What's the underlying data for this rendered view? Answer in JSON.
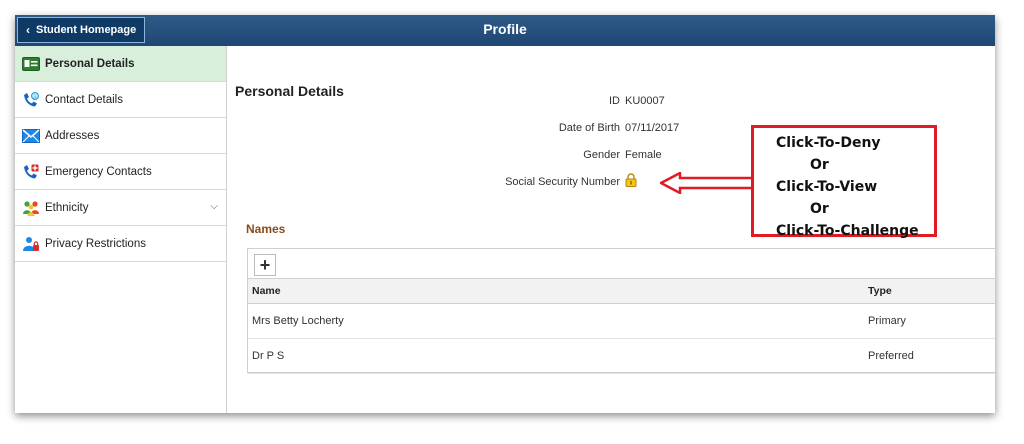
{
  "header": {
    "back_label": "Student Homepage",
    "title": "Profile"
  },
  "sidebar": {
    "items": [
      {
        "label": "Personal Details",
        "icon": "id-card-icon",
        "active": true
      },
      {
        "label": "Contact Details",
        "icon": "phone-email-icon"
      },
      {
        "label": "Addresses",
        "icon": "envelope-icon"
      },
      {
        "label": "Emergency Contacts",
        "icon": "phone-emergency-icon"
      },
      {
        "label": "Ethnicity",
        "icon": "people-icon",
        "expandable": true
      },
      {
        "label": "Privacy Restrictions",
        "icon": "user-lock-icon"
      }
    ]
  },
  "personal": {
    "section_title": "Personal Details",
    "fields": [
      {
        "label": "ID",
        "value": "KU0007"
      },
      {
        "label": "Date of Birth",
        "value": "07/11/2017"
      },
      {
        "label": "Gender",
        "value": "Female"
      },
      {
        "label": "Social Security Number",
        "value": ""
      }
    ]
  },
  "names": {
    "title": "Names",
    "columns": [
      "Name",
      "Type"
    ],
    "rows": [
      {
        "name": "Mrs Betty Locherty",
        "type": "Primary"
      },
      {
        "name": "Dr P S",
        "type": "Preferred"
      }
    ]
  },
  "callout": {
    "lines": [
      "Click-To-Deny",
      "Or",
      "Click-To-View",
      "Or",
      "Click-To-Challenge"
    ]
  },
  "colors": {
    "header": "#1f4674",
    "active_item": "#d8efdb",
    "names_title": "#8a4b1a",
    "callout_border": "#e01b24"
  }
}
